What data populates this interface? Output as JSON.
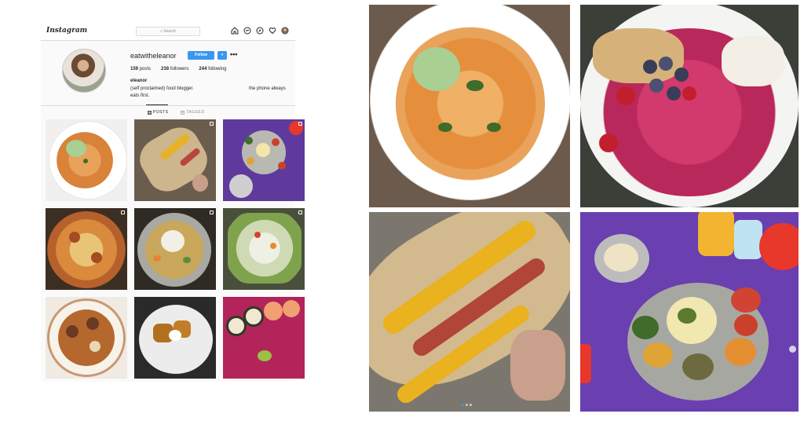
{
  "app": {
    "logo_text": "Instagram",
    "search_placeholder": "Search",
    "search_icon": "magnifier-icon",
    "nav_icons": [
      "home-icon",
      "messenger-icon",
      "explore-compass-icon",
      "heart-icon",
      "profile-avatar-icon"
    ]
  },
  "profile": {
    "username": "eatwitheleanor",
    "follow_label": "Follow",
    "dropdown_label": "▾",
    "more_label": "•••",
    "stats": {
      "posts_count": "159",
      "posts_label": " posts",
      "followers_count": "238",
      "followers_label": " followers",
      "following_count": "244",
      "following_label": " following"
    },
    "full_name": "eleanor",
    "bio_line1": "(self proclaimed) food blogger.",
    "bio_line2": "eats first.",
    "bio_side": "the phone always"
  },
  "tabs": [
    {
      "label": "POSTS",
      "icon": "grid-icon",
      "active": true
    },
    {
      "label": "TAGGED",
      "icon": "tag-icon",
      "active": false
    }
  ],
  "grid": [
    {
      "subject": "rigatoni pasta with green sauce",
      "multi": false
    },
    {
      "subject": "egg and cheese bagel sandwich",
      "multi": true
    },
    {
      "subject": "thali platter on purple table",
      "multi": true
    },
    {
      "subject": "pizza",
      "multi": true
    },
    {
      "subject": "matzo ball soup",
      "multi": true
    },
    {
      "subject": "salad with vegetables",
      "multi": true
    },
    {
      "subject": "meatball soup bowl",
      "multi": false
    },
    {
      "subject": "fried dumplings with egg",
      "multi": false
    },
    {
      "subject": "sushi rolls",
      "multi": false
    }
  ],
  "large_photos": [
    {
      "subject": "rigatoni pasta with green sauce",
      "carousel": true
    },
    {
      "subject": "berry smoothie bowl with granola",
      "carousel": false
    },
    {
      "subject": "egg and cheese bagel sandwich",
      "carousel": true
    },
    {
      "subject": "thali platter on purple table",
      "carousel": true
    }
  ],
  "colors": {
    "brand_blue": "#3897f0",
    "purple_table": "#6a3fb0",
    "border": "#dbdbdb"
  }
}
